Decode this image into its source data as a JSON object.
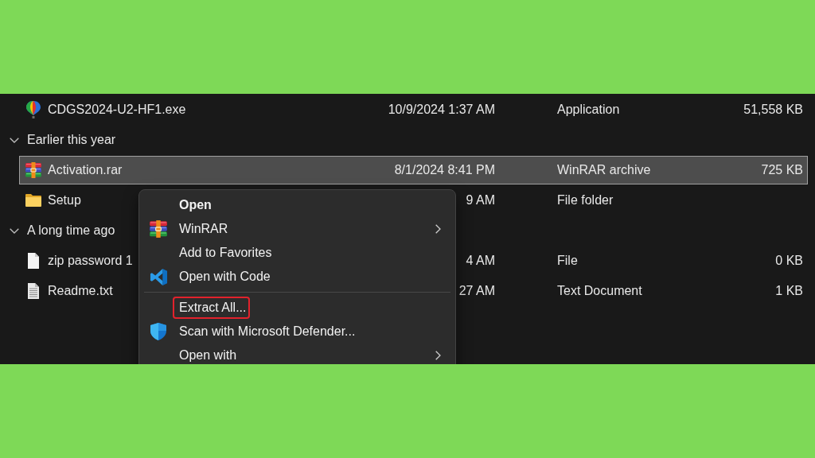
{
  "file_list": {
    "rows": [
      {
        "kind": "application",
        "name": "CDGS2024-U2-HF1.exe",
        "date": "10/9/2024 1:37 AM",
        "type": "Application",
        "size": "51,558 KB",
        "selected": false
      }
    ],
    "groups": [
      {
        "label": "Earlier this year",
        "expanded": true,
        "rows": [
          {
            "kind": "archive",
            "name": "Activation.rar",
            "date": "8/1/2024 8:41 PM",
            "type": "WinRAR archive",
            "size": "725 KB",
            "selected": true
          },
          {
            "kind": "folder",
            "name": "Setup",
            "date": "9 AM",
            "type": "File folder",
            "selected": false
          }
        ]
      },
      {
        "label": "A long time ago",
        "expanded": true,
        "rows": [
          {
            "kind": "file",
            "name": "zip password 1",
            "date": "4 AM",
            "type": "File",
            "size": "0 KB",
            "selected": false
          },
          {
            "kind": "text",
            "name": "Readme.txt",
            "date": "27 AM",
            "type": "Text Document",
            "size": "1 KB",
            "selected": false
          }
        ]
      }
    ]
  },
  "context_menu": {
    "items": [
      {
        "kind": "plain",
        "label": "Open",
        "default": true,
        "submenu": false,
        "highlighted": false
      },
      {
        "kind": "archiver",
        "label": "WinRAR",
        "default": false,
        "submenu": true,
        "highlighted": false
      },
      {
        "kind": "plain",
        "label": "Add to Favorites",
        "default": false,
        "submenu": false,
        "highlighted": false
      },
      {
        "kind": "editor",
        "label": "Open with Code",
        "default": false,
        "submenu": false,
        "highlighted": false
      },
      {
        "kind": "separator"
      },
      {
        "kind": "plain",
        "label": "Extract All...",
        "default": false,
        "submenu": false,
        "highlighted": true
      },
      {
        "kind": "antivirus",
        "label": "Scan with Microsoft Defender...",
        "default": false,
        "submenu": false,
        "highlighted": false
      },
      {
        "kind": "plain",
        "label": "Open with",
        "default": false,
        "submenu": true,
        "highlighted": false
      }
    ]
  }
}
